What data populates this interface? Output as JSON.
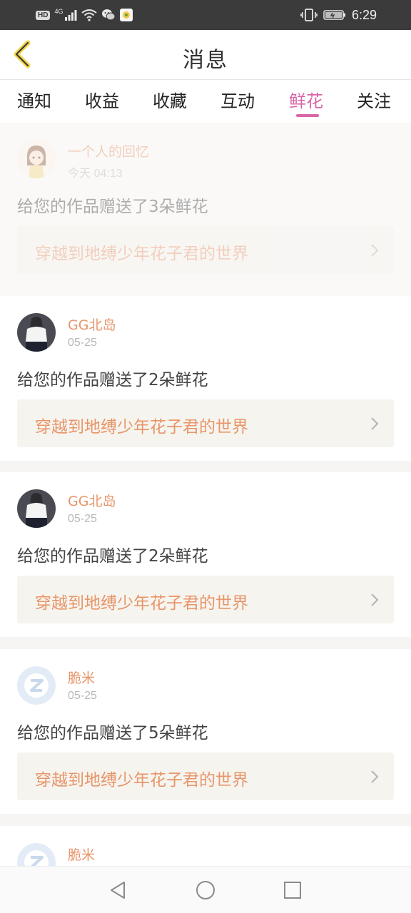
{
  "status_bar": {
    "hd": "HD",
    "network": "4G",
    "time": "6:29"
  },
  "header": {
    "title": "消息"
  },
  "tabs": [
    {
      "label": "通知",
      "active": false
    },
    {
      "label": "收益",
      "active": false
    },
    {
      "label": "收藏",
      "active": false
    },
    {
      "label": "互动",
      "active": false
    },
    {
      "label": "鲜花",
      "active": true
    },
    {
      "label": "关注",
      "active": false
    }
  ],
  "colors": {
    "accent": "#d966a8",
    "username": "#e8956a",
    "link_bg": "#f6f4ee"
  },
  "messages": [
    {
      "username": "一个人的回忆",
      "time": "今天 04:13",
      "text": "给您的作品赠送了3朵鲜花",
      "work": "穿越到地缚少年花子君的世界",
      "avatar": "anime-girl-avatar"
    },
    {
      "username": "GG北岛",
      "time": "05-25",
      "text": "给您的作品赠送了2朵鲜花",
      "work": "穿越到地缚少年花子君的世界",
      "avatar": "photo-avatar"
    },
    {
      "username": "GG北岛",
      "time": "05-25",
      "text": "给您的作品赠送了2朵鲜花",
      "work": "穿越到地缚少年花子君的世界",
      "avatar": "photo-avatar"
    },
    {
      "username": "脆米",
      "time": "05-25",
      "text": "给您的作品赠送了5朵鲜花",
      "work": "穿越到地缚少年花子君的世界",
      "avatar": "default-avatar"
    },
    {
      "username": "脆米",
      "time": "",
      "text": "",
      "work": "",
      "avatar": "default-avatar"
    }
  ],
  "nav": {
    "back": "back-triangle-icon",
    "home": "home-circle-icon",
    "recent": "recent-square-icon"
  }
}
